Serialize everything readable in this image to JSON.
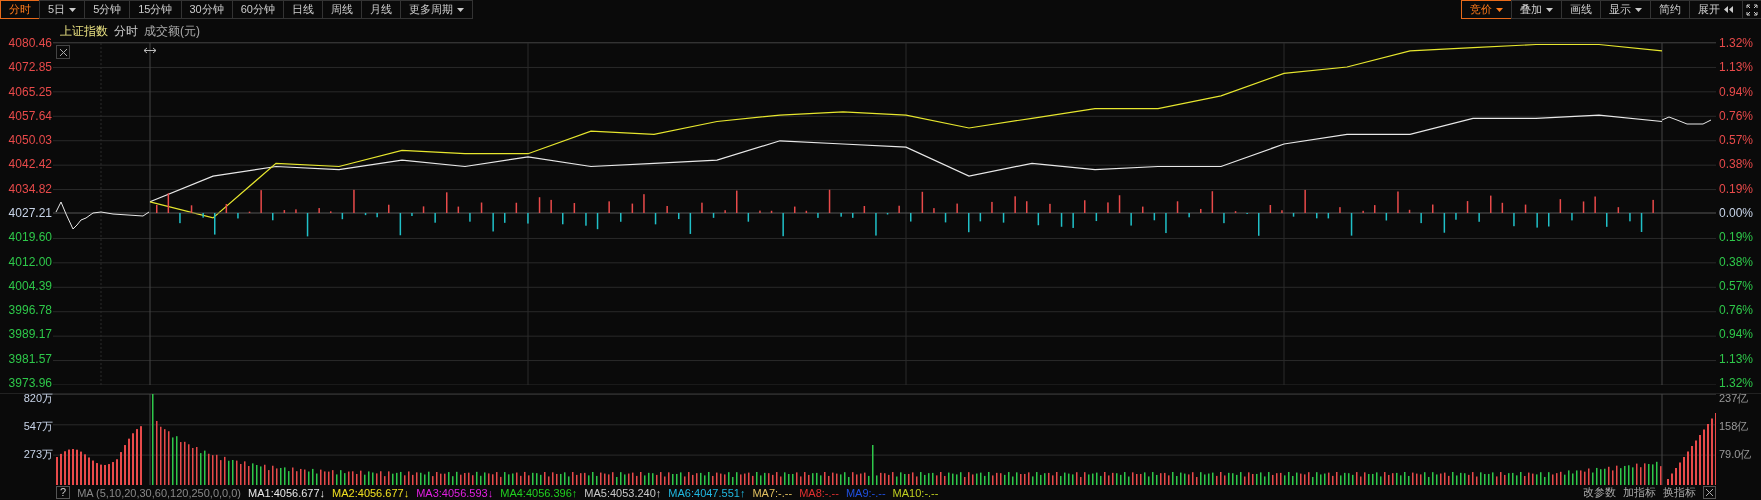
{
  "toolbar_left": [
    {
      "label": "分时",
      "selected": true,
      "kind": "plain"
    },
    {
      "label": "5日",
      "selected": false,
      "kind": "dropdown"
    },
    {
      "label": "5分钟",
      "selected": false,
      "kind": "plain"
    },
    {
      "label": "15分钟",
      "selected": false,
      "kind": "plain"
    },
    {
      "label": "30分钟",
      "selected": false,
      "kind": "plain"
    },
    {
      "label": "60分钟",
      "selected": false,
      "kind": "plain"
    },
    {
      "label": "日线",
      "selected": false,
      "kind": "plain"
    },
    {
      "label": "周线",
      "selected": false,
      "kind": "plain"
    },
    {
      "label": "月线",
      "selected": false,
      "kind": "plain"
    },
    {
      "label": "更多周期",
      "selected": false,
      "kind": "dropdown"
    }
  ],
  "toolbar_right": [
    {
      "label": "竞价",
      "selected": true,
      "kind": "dropdown"
    },
    {
      "label": "叠加",
      "selected": false,
      "kind": "dropdown"
    },
    {
      "label": "画线",
      "selected": false,
      "kind": "plain"
    },
    {
      "label": "显示",
      "selected": false,
      "kind": "dropdown"
    },
    {
      "label": "简约",
      "selected": false,
      "kind": "plain"
    },
    {
      "label": "展开",
      "selected": false,
      "kind": "expand"
    }
  ],
  "header": {
    "title": "上证指数",
    "mode": "分时",
    "indicator": "成交额(元)"
  },
  "percent_axis": [
    {
      "label": "1.32%",
      "color": "#e84a4a"
    },
    {
      "label": "1.13%",
      "color": "#e84a4a"
    },
    {
      "label": "0.94%",
      "color": "#e84a4a"
    },
    {
      "label": "0.76%",
      "color": "#e84a4a"
    },
    {
      "label": "0.57%",
      "color": "#e84a4a"
    },
    {
      "label": "0.38%",
      "color": "#e84a4a"
    },
    {
      "label": "0.19%",
      "color": "#e84a4a"
    },
    {
      "label": "0.00%",
      "color": "#c8d4e8"
    },
    {
      "label": "0.19%",
      "color": "#2ec84a"
    },
    {
      "label": "0.38%",
      "color": "#2ec84a"
    },
    {
      "label": "0.57%",
      "color": "#2ec84a"
    },
    {
      "label": "0.76%",
      "color": "#2ec84a"
    },
    {
      "label": "0.94%",
      "color": "#2ec84a"
    },
    {
      "label": "1.13%",
      "color": "#2ec84a"
    },
    {
      "label": "1.32%",
      "color": "#2ec84a"
    }
  ],
  "chart_data": {
    "type": "line",
    "grid": true,
    "ylim": [
      3973.96,
      4080.46
    ],
    "yticks": [
      {
        "value": 4080.46,
        "label": "4080.46"
      },
      {
        "value": 4072.85,
        "label": "4072.85"
      },
      {
        "value": 4065.25,
        "label": "4065.25"
      },
      {
        "value": 4057.64,
        "label": "4057.64"
      },
      {
        "value": 4050.03,
        "label": "4050.03"
      },
      {
        "value": 4042.42,
        "label": "4042.42"
      },
      {
        "value": 4034.82,
        "label": "4034.82"
      },
      {
        "value": 4027.21,
        "label": "4027.21"
      },
      {
        "value": 4019.6,
        "label": "4019.60"
      },
      {
        "value": 4012.0,
        "label": "4012.00"
      },
      {
        "value": 4004.39,
        "label": "4004.39"
      },
      {
        "value": 3996.78,
        "label": "3996.78"
      },
      {
        "value": 3989.17,
        "label": "3989.17"
      },
      {
        "value": 3981.57,
        "label": "3981.57"
      },
      {
        "value": 3973.96,
        "label": "3973.96"
      }
    ],
    "series": [
      {
        "color": "#e8e8e8",
        "values": [
          4031,
          4039,
          4042,
          4041,
          4044,
          4042,
          4045,
          4042,
          4043,
          4044,
          4050,
          4049,
          4048,
          4039,
          4043,
          4041,
          4042,
          4042,
          4049,
          4052,
          4052,
          4057,
          4057,
          4058,
          4056
        ]
      },
      {
        "color": "#e6e62e",
        "values": [
          4031,
          4026,
          4043,
          4042,
          4047,
          4046,
          4046,
          4053,
          4052,
          4056,
          4058,
          4059,
          4058,
          4054,
          4057,
          4060,
          4060,
          4064,
          4071,
          4073,
          4078,
          4079,
          4080,
          4080,
          4078
        ]
      }
    ]
  },
  "volume": {
    "axis_left": [
      "820万",
      "547万",
      "273万"
    ],
    "axis_right": [
      "237亿",
      "158亿",
      "79.0亿"
    ]
  },
  "indicator_bar": {
    "help": "?",
    "params": "MA (5,10,20,30,60,120,250,0,0,0)",
    "ma": [
      {
        "label": "MA1:4056.677↓",
        "color": "#e8e8e8"
      },
      {
        "label": "MA2:4056.677↓",
        "color": "#f0e020"
      },
      {
        "label": "MA3:4056.593↓",
        "color": "#e020e0"
      },
      {
        "label": "MA4:4056.396↑",
        "color": "#20d020"
      },
      {
        "label": "MA5:4053.240↑",
        "color": "#c8c8c8"
      },
      {
        "label": "MA6:4047.551↑",
        "color": "#20b8e0"
      },
      {
        "label": "MA7:-.--",
        "color": "#e0c060"
      },
      {
        "label": "MA8:-.--",
        "color": "#e03030"
      },
      {
        "label": "MA9:-.--",
        "color": "#2050e0"
      },
      {
        "label": "MA10:-.--",
        "color": "#c0d020"
      }
    ],
    "actions": [
      "改参数",
      "加指标",
      "换指标"
    ]
  }
}
